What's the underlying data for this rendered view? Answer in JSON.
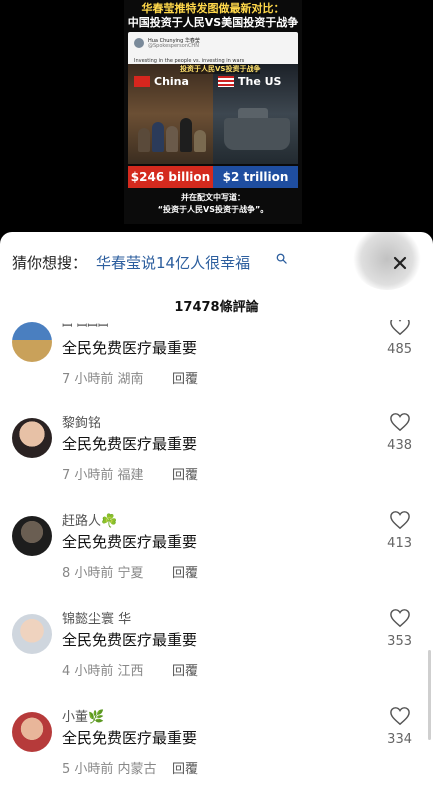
{
  "video": {
    "overlay_line_1": "华春莹推特发图做最新对比：",
    "overlay_line_2": "中国投资于人民VS美国投资于战争",
    "tweet_name": "Hua Chunying 华春莹",
    "tweet_handle": "@SpokespersonCHN",
    "tweet_text": "Investing in the people vs. investing in wars",
    "image_caption": "投资于人民VS投资于战争",
    "country_left": "China",
    "country_right": "The US",
    "amount_left": "$246 billion",
    "amount_right": "$2 trillion",
    "subtitle_1": "并在配文中写道：",
    "subtitle_2": "“投资于人民VS投资于战争”。"
  },
  "search": {
    "label": "猜你想搜：",
    "query": "华春莹说14亿人很幸福",
    "icon": "search-icon"
  },
  "close_icon": "close-icon",
  "comments_header": "17478條評論",
  "comments": [
    {
      "user": "ꟷ ꟷꟷꟷ",
      "text": "全民免费医疗最重要",
      "time": "7 小時前",
      "location": "湖南",
      "reply": "回覆",
      "likes": "485"
    },
    {
      "user": "黎鉤铭",
      "text": "全民免费医疗最重要",
      "time": "7 小時前",
      "location": "福建",
      "reply": "回覆",
      "likes": "438"
    },
    {
      "user": "赶路人☘️",
      "text": "全民免费医疗最重要",
      "time": "8 小時前",
      "location": "宁夏",
      "reply": "回覆",
      "likes": "413"
    },
    {
      "user": "锦懿尘寰  华",
      "text": "全民免费医疗最重要",
      "time": "4 小時前",
      "location": "江西",
      "reply": "回覆",
      "likes": "353"
    },
    {
      "user": "小董🌿",
      "text": "全民免费医疗最重要",
      "time": "5 小時前",
      "location": "内蒙古",
      "reply": "回覆",
      "likes": "334"
    }
  ],
  "colors": {
    "link": "#2c5e9e",
    "cn_banner": "#d42a1e",
    "us_banner": "#1f4ea0"
  }
}
